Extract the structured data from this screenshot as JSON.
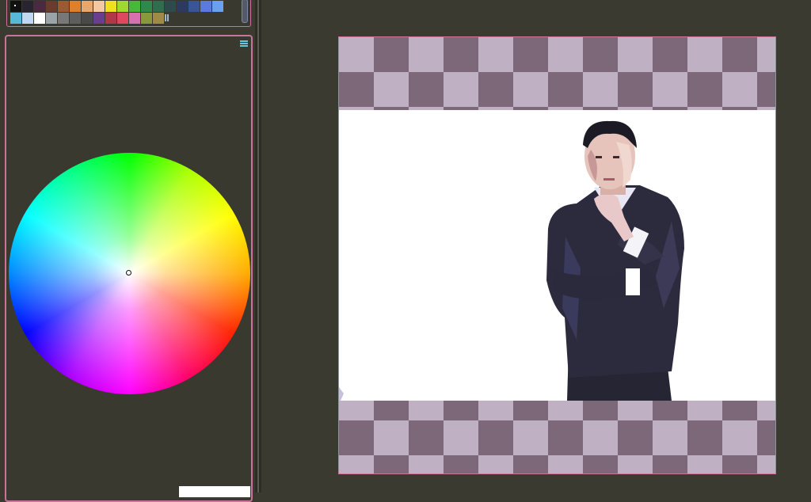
{
  "palette": {
    "row1": [
      "#111111",
      "#2a2430",
      "#4a2a40",
      "#6b3b2e",
      "#9c5a33",
      "#e07f2a",
      "#e8a86b",
      "#f4c8a0",
      "#f0e020",
      "#9fd830",
      "#48b838",
      "#2e8a4a",
      "#2e6e4e",
      "#2f4a4a",
      "#2b3a5e",
      "#3a5498",
      "#5a7ae0",
      "#6aa0f0"
    ],
    "row2": [
      "#58b8d8",
      "#c0d8f0",
      "#ffffff",
      "#9aa4a8",
      "#787878",
      "#5e5e5e",
      "#4a4a4a",
      "#6a3e8e",
      "#b03848",
      "#e04860",
      "#d870b0",
      "#88983a",
      "#a08a48"
    ],
    "selected_index": 0
  },
  "colorwheel": {
    "preview_color": "#ffffff"
  },
  "canvas": {
    "checker_dark": "#7d687a",
    "checker_light": "#c0b0c3"
  }
}
